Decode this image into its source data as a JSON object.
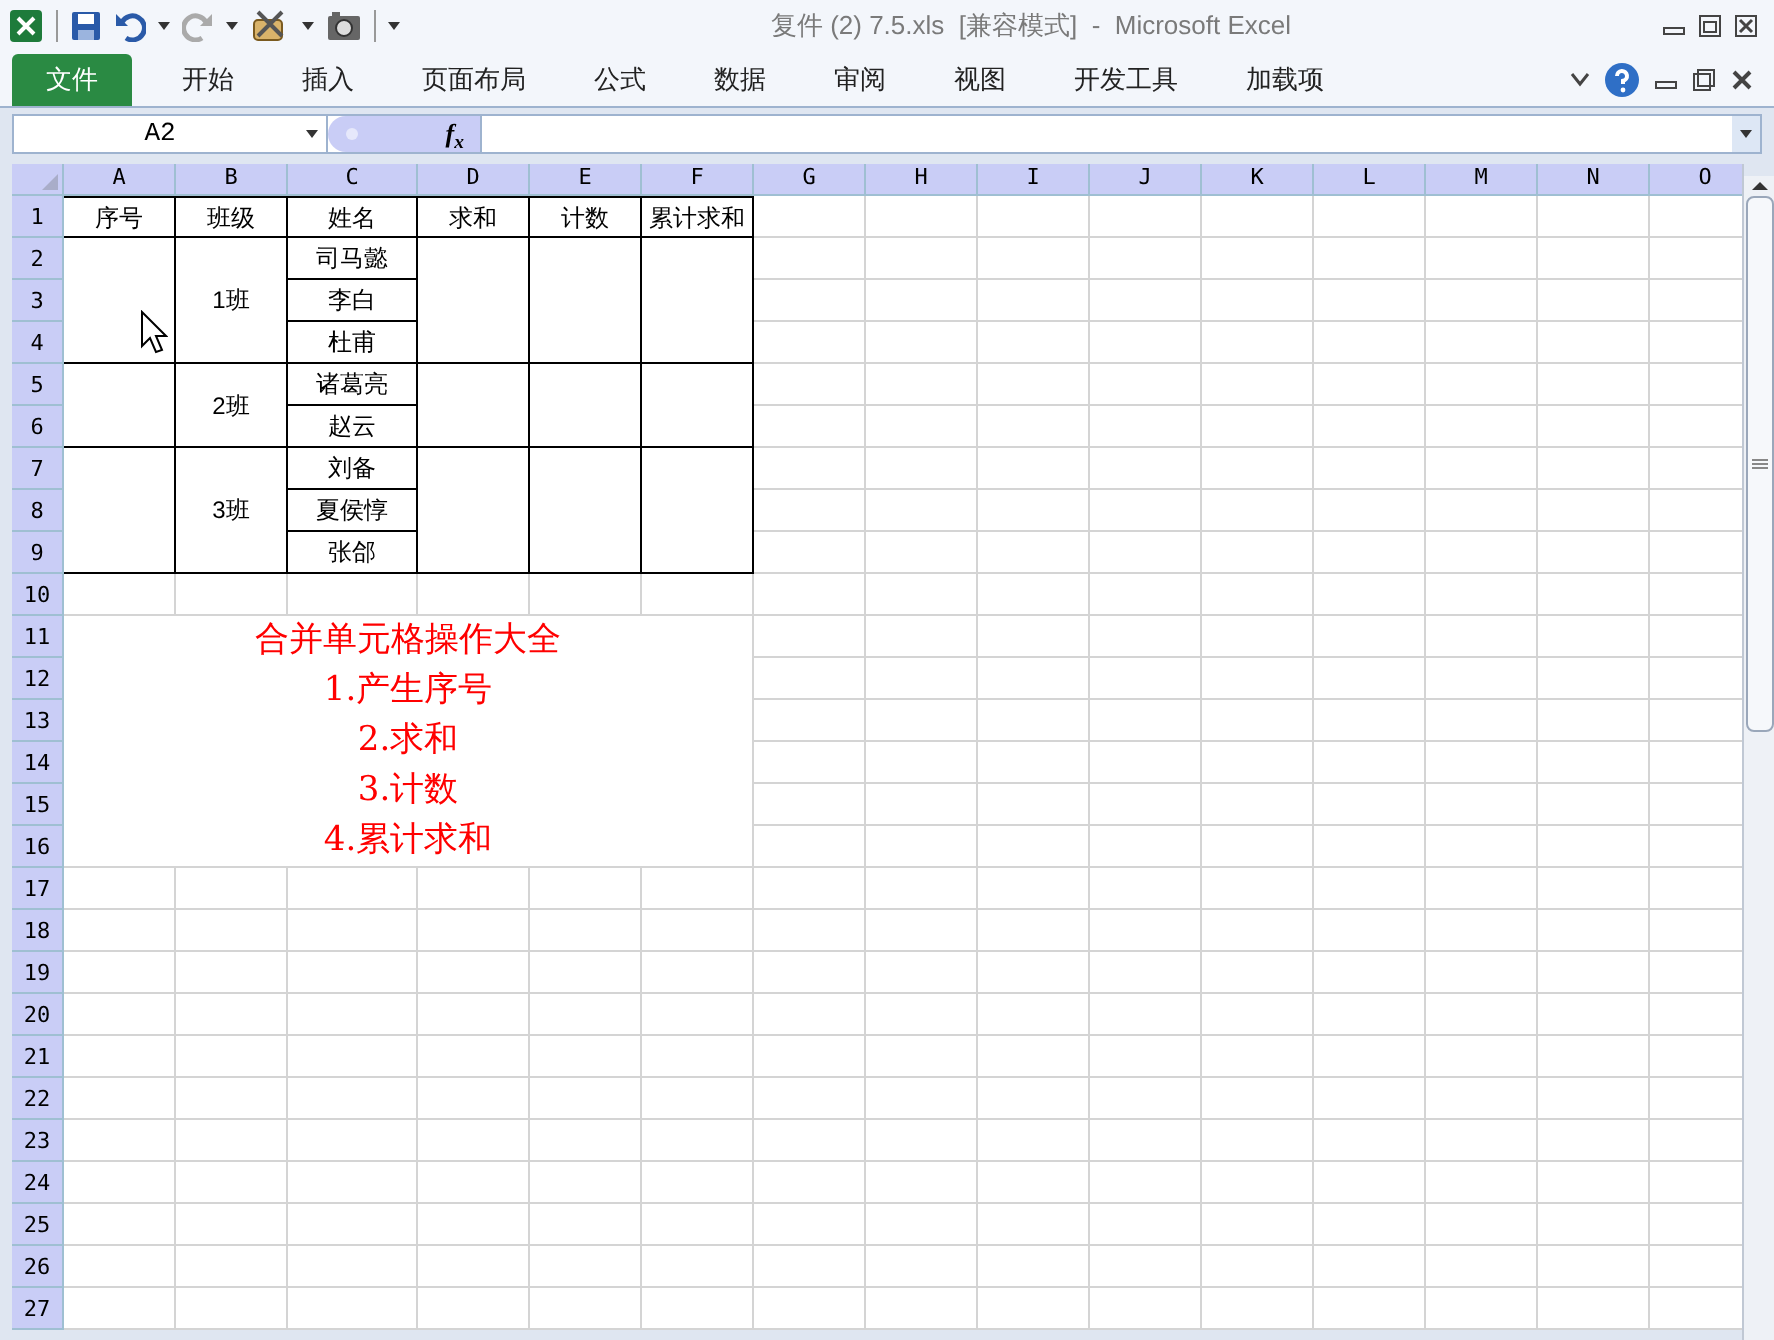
{
  "window": {
    "title": "复件 (2) 7.5.xls  [兼容模式]  -  Microsoft Excel"
  },
  "ribbon_tabs": [
    {
      "label": "文件",
      "kind": "file",
      "selected": false
    },
    {
      "label": "开始",
      "kind": "tab",
      "selected": false
    },
    {
      "label": "插入",
      "kind": "tab",
      "selected": false
    },
    {
      "label": "页面布局",
      "kind": "tab",
      "selected": false
    },
    {
      "label": "公式",
      "kind": "tab",
      "selected": false
    },
    {
      "label": "数据",
      "kind": "tab",
      "selected": false
    },
    {
      "label": "审阅",
      "kind": "tab",
      "selected": false
    },
    {
      "label": "视图",
      "kind": "tab",
      "selected": false
    },
    {
      "label": "开发工具",
      "kind": "tab",
      "selected": false
    },
    {
      "label": "加载项",
      "kind": "tab",
      "selected": false
    }
  ],
  "formula_bar": {
    "name_box": "A2",
    "fx_label": "f$_{x}$"
  },
  "sheet": {
    "column_headers": [
      "A",
      "B",
      "C",
      "D",
      "E",
      "F",
      "G",
      "H",
      "I",
      "J",
      "K",
      "L",
      "M",
      "N",
      "O"
    ],
    "row_headers": [
      "1",
      "2",
      "3",
      "4",
      "5",
      "6",
      "7",
      "8",
      "9",
      "10",
      "11",
      "12",
      "13",
      "14",
      "15",
      "16",
      "17",
      "18",
      "19",
      "20",
      "21",
      "22",
      "23",
      "24",
      "25",
      "26",
      "27"
    ],
    "table": {
      "headers": [
        "序号",
        "班级",
        "姓名",
        "求和",
        "计数",
        "累计求和"
      ],
      "groups": [
        {
          "class": "1班",
          "names": [
            "司马懿",
            "李白",
            "杜甫"
          ]
        },
        {
          "class": "2班",
          "names": [
            "诸葛亮",
            "赵云"
          ]
        },
        {
          "class": "3班",
          "names": [
            "刘备",
            "夏侯惇",
            "张郃"
          ]
        }
      ]
    },
    "notes": [
      "合并单元格操作大全",
      "1.产生序号",
      "2.求和",
      "3.计数",
      "4.累计求和"
    ]
  }
}
